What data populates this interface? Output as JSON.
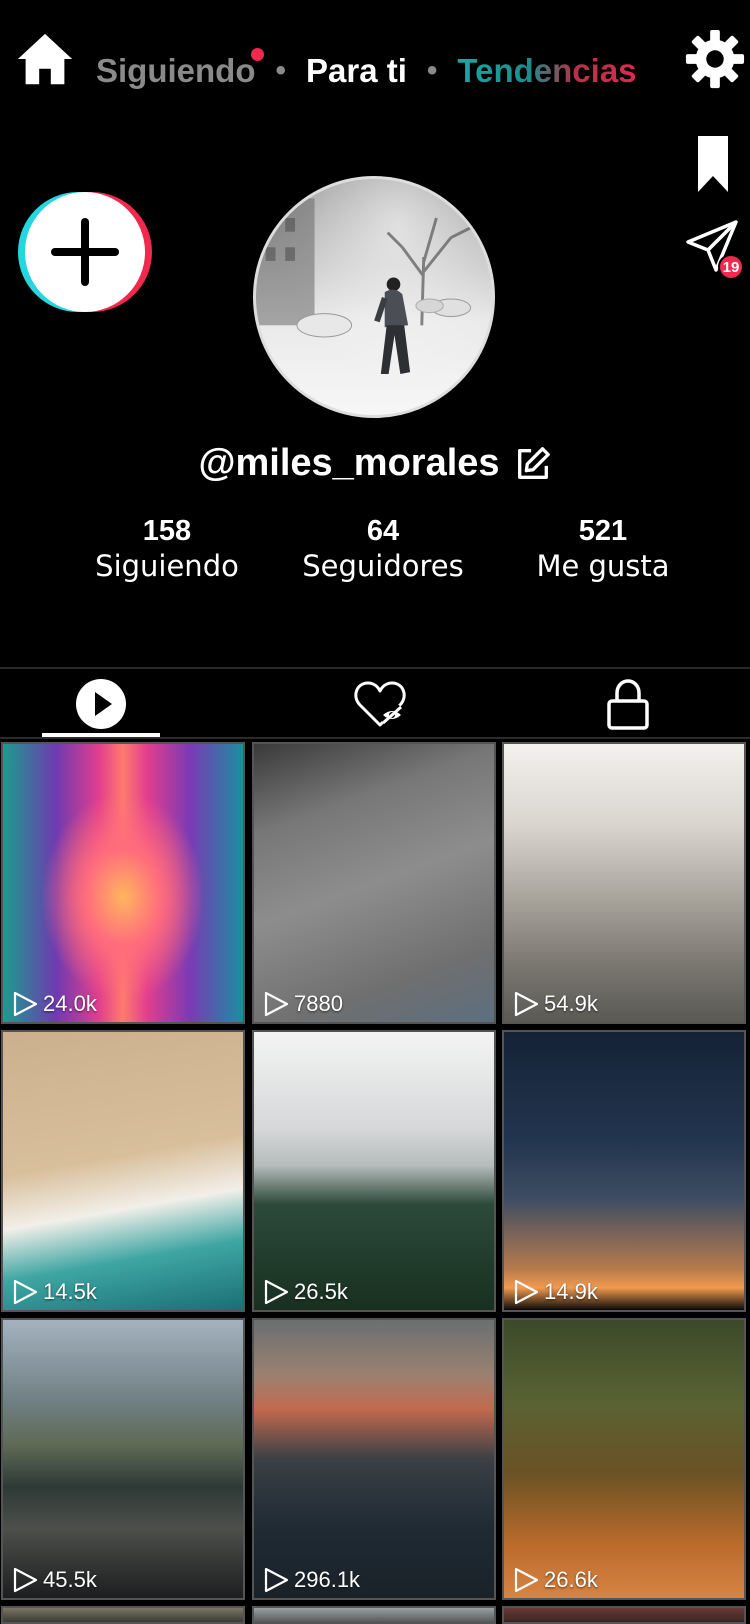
{
  "topnav": {
    "tabs": {
      "following": "Siguiendo",
      "for_you": "Para ti",
      "trending": "Tendencias"
    },
    "separator": "•",
    "following_has_notification": true
  },
  "icons": {
    "home": "home-icon",
    "settings": "gear-icon",
    "bookmark": "bookmark-icon",
    "send": "send-icon",
    "add": "plus-icon",
    "edit": "edit-icon",
    "videos_tab": "play-icon",
    "liked_tab": "heart-hidden-icon",
    "private_tab": "lock-icon"
  },
  "inbox": {
    "badge": "19"
  },
  "profile": {
    "username": "@miles_morales",
    "stats": [
      {
        "value": "158",
        "label": "Siguiendo"
      },
      {
        "value": "64",
        "label": "Seguidores"
      },
      {
        "value": "521",
        "label": "Me gusta"
      }
    ]
  },
  "profile_tabs": {
    "active": "videos"
  },
  "videos": [
    {
      "views": "24.0k"
    },
    {
      "views": "7880"
    },
    {
      "views": "54.9k"
    },
    {
      "views": "14.5k"
    },
    {
      "views": "26.5k"
    },
    {
      "views": "14.9k"
    },
    {
      "views": "45.5k"
    },
    {
      "views": "296.1k"
    },
    {
      "views": "26.6k"
    }
  ],
  "colors": {
    "background": "#000000",
    "accent_red": "#f2294e",
    "accent_cyan": "#25d6df",
    "muted": "#8a8a8a"
  }
}
